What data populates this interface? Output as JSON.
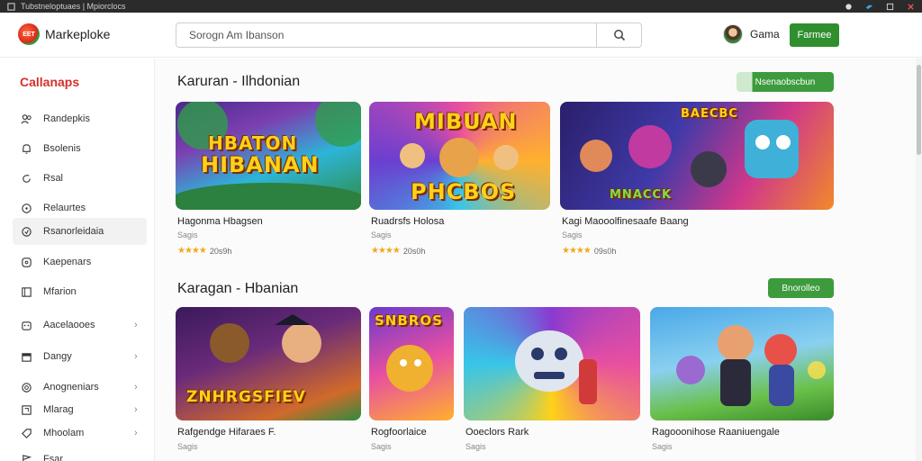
{
  "system_bar": {
    "title": "Tubstneloptuaes | Mpiorclocs"
  },
  "header": {
    "logo_badge": "EET",
    "logo_text": "Markeploke",
    "search_placeholder": "Sorogn Am Ibanson",
    "user_name": "Gama",
    "cta_label": "Farmee"
  },
  "sidebar": {
    "title": "Callanaps",
    "items": [
      {
        "label": "Randepkis",
        "icon": "users-icon"
      },
      {
        "label": "Bsolenis",
        "icon": "bell-icon"
      },
      {
        "label": "Rsal",
        "icon": "refresh-icon"
      },
      {
        "label": "Relaurtes",
        "icon": "compass-icon"
      },
      {
        "label": "Rsanorleidaia",
        "icon": "heart-icon"
      },
      {
        "label": "Kaepenars",
        "icon": "gamepad-icon"
      },
      {
        "label": "Mfarion",
        "icon": "grid-icon"
      },
      {
        "label": "Aacelaooes",
        "icon": "robot-icon"
      },
      {
        "label": "Dangy",
        "icon": "calendar-icon"
      },
      {
        "label": "Anogneniars",
        "icon": "target-icon"
      },
      {
        "label": "Mlarag",
        "icon": "puzzle-icon"
      },
      {
        "label": "Mhoolam",
        "icon": "tag-icon"
      },
      {
        "label": "Fsar",
        "icon": "flag-icon"
      }
    ]
  },
  "main": {
    "sections": [
      {
        "title": "Karuran - Ilhdonian",
        "see_all": "Nsenaobscbun",
        "cards": [
          {
            "title": "Hagonma Hbagsen",
            "sub": "Sagis",
            "rating_count": "20s9h",
            "art_text_1": "HBATON",
            "art_text_2": "HIBANAN"
          },
          {
            "title": "Ruadrsfs Holosa",
            "sub": "Sagis",
            "rating_count": "20s0h",
            "art_text_1": "MIBUAN",
            "art_text_2": "PHCBOS"
          },
          {
            "title": "Kagi Maooolfinesaafe Baang",
            "sub": "Sagis",
            "rating_count": "09s0h",
            "art_text_1": "BAECBC",
            "art_text_2": "MNACCK"
          }
        ]
      },
      {
        "title": "Karagan - Hbanian",
        "see_all": "Bnorolleo",
        "cards": [
          {
            "title": "Rafgendge Hifaraes F.",
            "sub": "Sagis",
            "art_text_1": "ZNHRGSFIEV"
          },
          {
            "title": "Rogfoorlaice",
            "sub": "Sagis",
            "art_text_1": "SNBROS"
          },
          {
            "title": "Ooeclors Rark",
            "sub": "Sagis"
          },
          {
            "title": "Ragooonihose Raaniuengale",
            "sub": "Sagis"
          }
        ]
      }
    ]
  },
  "colors": {
    "brand_green": "#2f8f2f",
    "accent_red": "#d4322a",
    "star": "#f2a81d"
  }
}
